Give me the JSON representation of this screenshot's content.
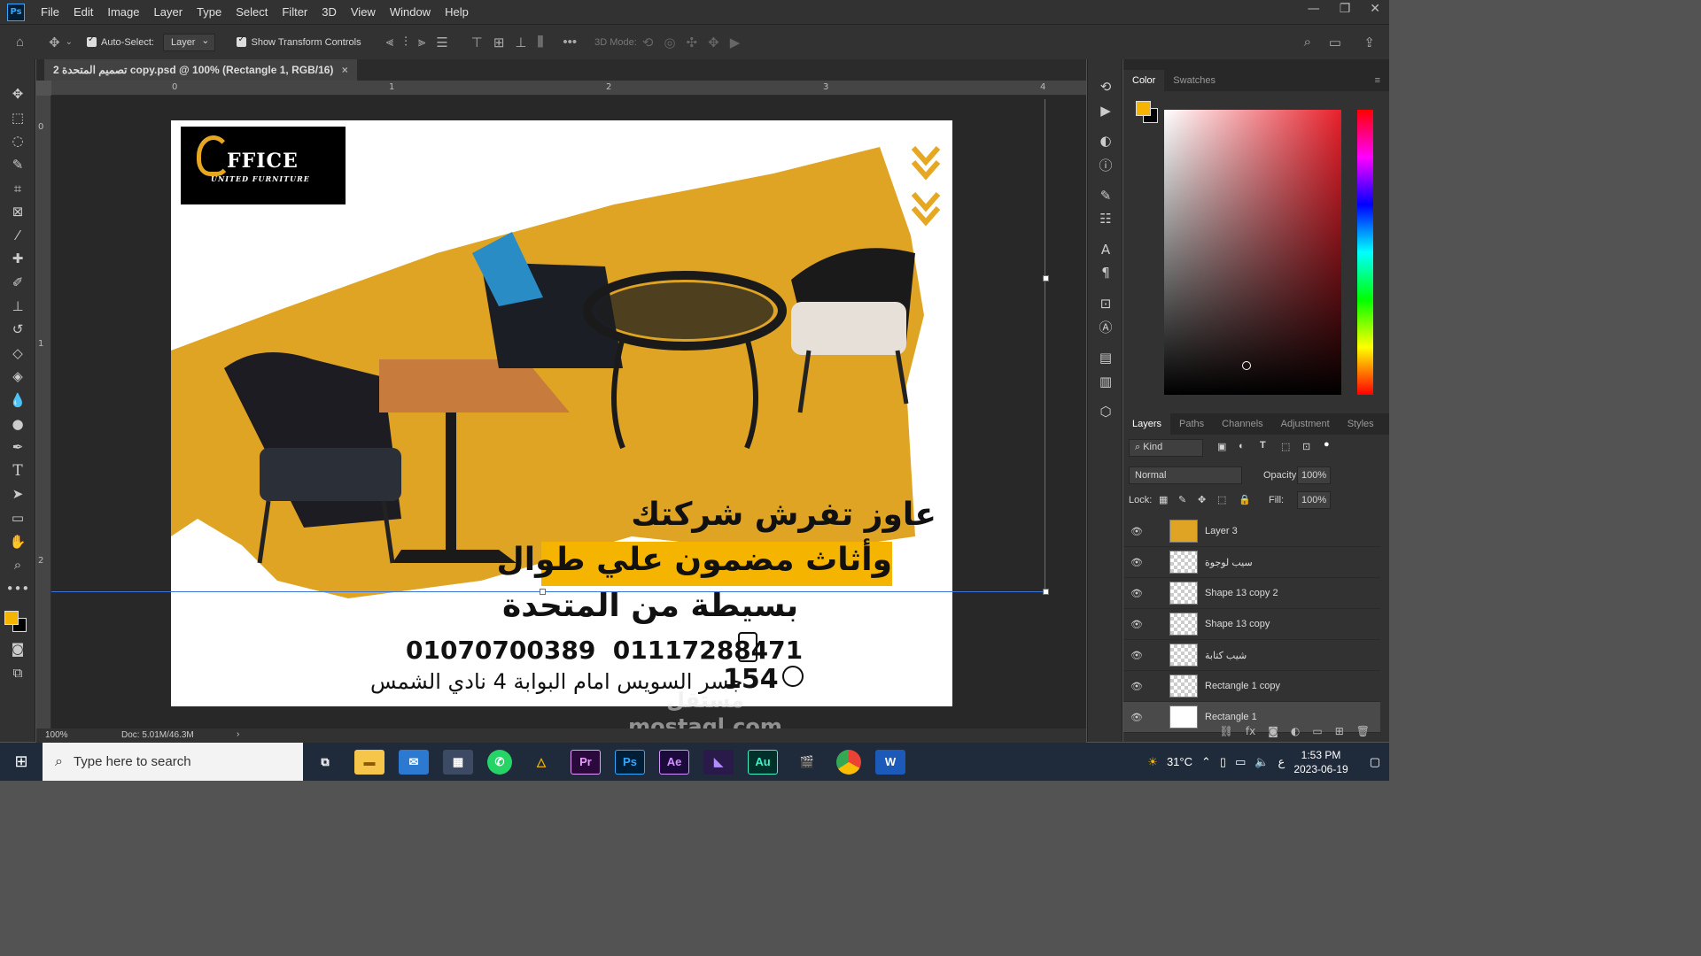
{
  "menu": [
    "File",
    "Edit",
    "Image",
    "Layer",
    "Type",
    "Select",
    "Filter",
    "3D",
    "View",
    "Window",
    "Help"
  ],
  "app_logo": "Ps",
  "options": {
    "auto_select": "Auto-Select:",
    "layer_select": "Layer",
    "show_transform": "Show Transform Controls",
    "mode3d": "3D Mode:"
  },
  "doc_tab": "2 تصميم المتحدة copy.psd @ 100% (Rectangle 1, RGB/16)",
  "ruler_h": [
    "0",
    "1",
    "2",
    "3",
    "4"
  ],
  "ruler_v": [
    "0",
    "1",
    "2"
  ],
  "artwork": {
    "logo_main": "FFICE",
    "logo_sub": "UNITED FURNITURE",
    "line1": "عاوز تفرش شركتك",
    "line2": "وأثاث مضمون علي طوال",
    "line3": "بسيطة من المتحدة",
    "phones": "01070700389  01117288471",
    "address_num": "154",
    "address": "جسر السويس امام البوابة 4 نادي الشمس",
    "accent": "#e6a722"
  },
  "status": {
    "zoom": "100%",
    "doc": "Doc: 5.01M/46.3M"
  },
  "color_panel": {
    "tabs": [
      "Color",
      "Swatches"
    ],
    "fg": "#f5b400",
    "bg": "#000000"
  },
  "layers_panel": {
    "tabs": [
      "Layers",
      "Paths",
      "Channels",
      "Adjustment",
      "Styles"
    ],
    "kind": "Kind",
    "blend": "Normal",
    "opacity_label": "Opacity:",
    "opacity": "100%",
    "lock_label": "Lock:",
    "fill_label": "Fill:",
    "fill": "100%",
    "layers": [
      "Layer 3",
      "سيب لوجوة",
      "Shape 13 copy 2",
      "Shape 13 copy",
      "شيب كتابة",
      "Rectangle 1 copy",
      "Rectangle 1"
    ]
  },
  "taskbar": {
    "search": "Type here to search",
    "temp": "31°C",
    "lang": "ع",
    "time": "1:53 PM",
    "date": "2023-06-19"
  },
  "watermark": "مستقل mostaql.com"
}
